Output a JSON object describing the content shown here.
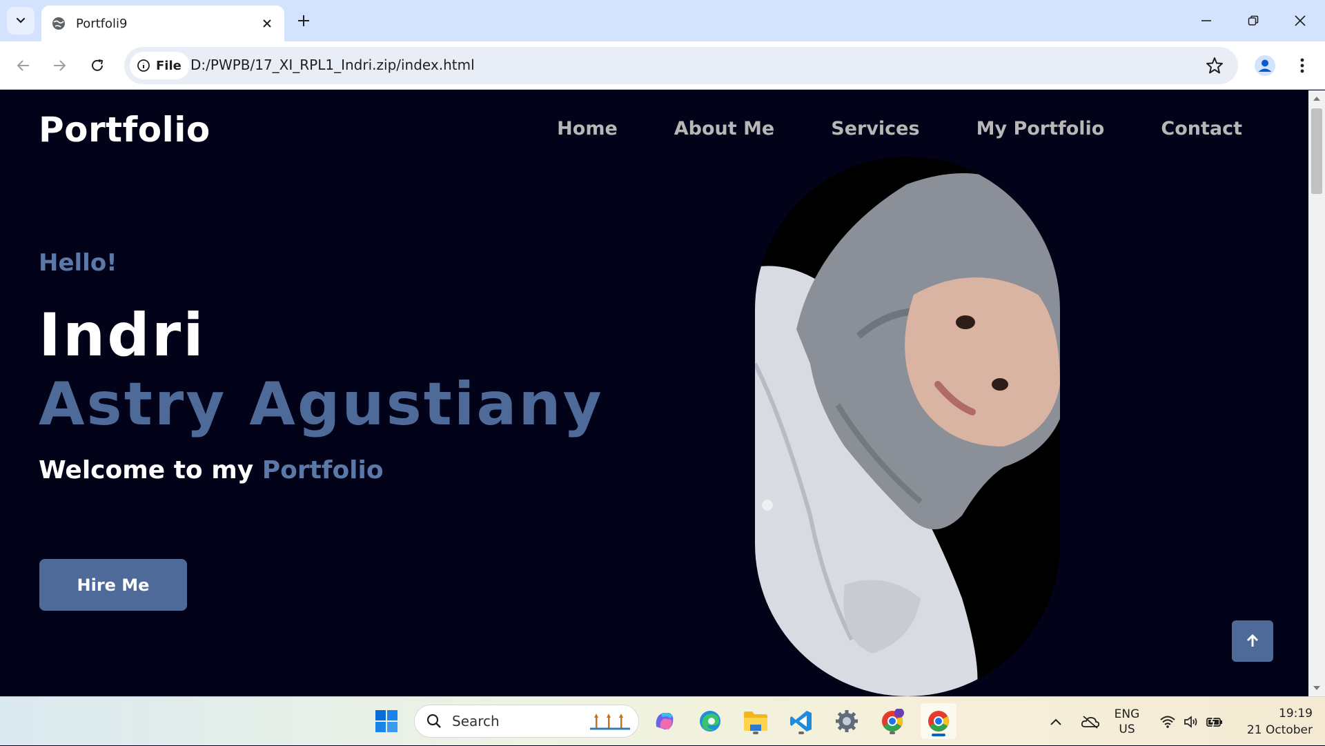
{
  "browser": {
    "tab_title": "Portfoli9",
    "chip_label": "File",
    "url": "D:/PWPB/17_XI_RPL1_Indri.zip/index.html"
  },
  "site": {
    "brand": "Portfolio",
    "nav": [
      "Home",
      "About Me",
      "Services",
      "My Portfolio",
      "Contact"
    ],
    "hello": "Hello!",
    "first_name": "Indri",
    "last_name": "Astry Agustiany",
    "welcome_prefix": "Welcome to my ",
    "welcome_accent": "Portfolio",
    "hire_button": "Hire Me"
  },
  "taskbar": {
    "search_label": "Search",
    "lang_line1": "ENG",
    "lang_line2": "US",
    "time": "19:19",
    "date": "21 October"
  },
  "colors": {
    "page_bg": "#020218",
    "accent": "#4d6a99",
    "nav_text": "#b7b7b7"
  }
}
